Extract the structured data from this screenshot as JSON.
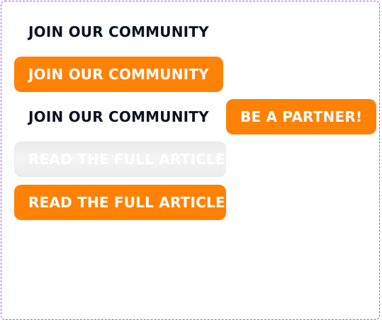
{
  "buttons": {
    "join_text": "JOIN OUR COMMUNITY",
    "join_primary": "JOIN OUR COMMUNITY",
    "join_text_2": "JOIN OUR COMMUNITY",
    "partner": "BE A PARTNER!",
    "read_disabled": "READ THE FULL ARTICLE",
    "read_primary": "READ THE FULL ARTICLE"
  },
  "colors": {
    "accent": "#ff8106",
    "text_dark": "#0b1220",
    "disabled_bg": "#ebebeb",
    "frame_border": "#9b5cff"
  }
}
